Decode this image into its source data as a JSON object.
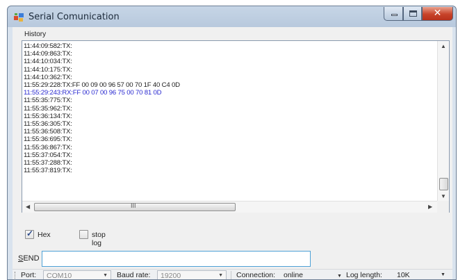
{
  "window": {
    "title": "Serial Comunication"
  },
  "history": {
    "label": "History",
    "lines": [
      {
        "text": "11:44:09:582:TX:",
        "dir": "tx"
      },
      {
        "text": "11:44:09:863:TX:",
        "dir": "tx"
      },
      {
        "text": "11:44:10:034:TX:",
        "dir": "tx"
      },
      {
        "text": "11:44:10:175:TX:",
        "dir": "tx"
      },
      {
        "text": "11:44:10:362:TX:",
        "dir": "tx"
      },
      {
        "text": "11:55:29:228:TX:FF 00 09 00 96 57 00 70 1F 40 C4 0D",
        "dir": "tx"
      },
      {
        "text": "11:55:29:243:RX:FF 00 07 00 96 75 00 70 81 0D",
        "dir": "rx"
      },
      {
        "text": "11:55:35:775:TX:",
        "dir": "tx"
      },
      {
        "text": "11:55:35:962:TX:",
        "dir": "tx"
      },
      {
        "text": "11:55:36:134:TX:",
        "dir": "tx"
      },
      {
        "text": "11:55:36:305:TX:",
        "dir": "tx"
      },
      {
        "text": "11:55:36:508:TX:",
        "dir": "tx"
      },
      {
        "text": "11:55:36:695:TX:",
        "dir": "tx"
      },
      {
        "text": "11:55:36:867:TX:",
        "dir": "tx"
      },
      {
        "text": "11:55:37:054:TX:",
        "dir": "tx"
      },
      {
        "text": "11:55:37:288:TX:",
        "dir": "tx"
      },
      {
        "text": "11:55:37:819:TX:",
        "dir": "tx"
      }
    ],
    "hscroll_grip": "III"
  },
  "options": {
    "hex_label": "Hex",
    "hex_checked": true,
    "stop_log_label": "stop log",
    "stop_log_checked": false
  },
  "send": {
    "label_access_key": "S",
    "label_rest": "END",
    "value": ""
  },
  "status": {
    "port_label": "Port:",
    "port_value": "COM10",
    "baud_label": "Baud rate:",
    "baud_value": "19200",
    "connection_label": "Connection:",
    "connection_value": "online",
    "log_length_label": "Log length:",
    "log_length_value": "10K"
  },
  "colors": {
    "tx_text": "#1d1d1d",
    "rx_text": "#2a2ad0",
    "send_border": "#4ea1d6",
    "close_button": "#c8432a"
  }
}
